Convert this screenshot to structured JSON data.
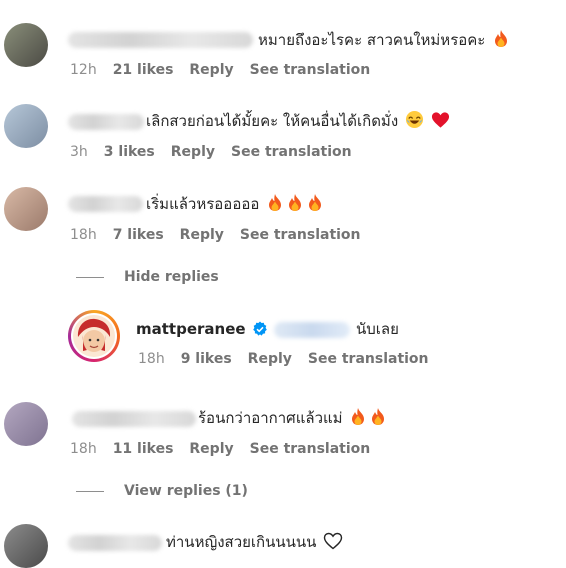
{
  "labels": {
    "reply": "Reply",
    "see_translation": "See translation"
  },
  "comments": [
    {
      "text": "หมายถึงอะไรคะ สาวคนใหม่หรอคะ",
      "age": "12h",
      "likes": "21 likes"
    },
    {
      "text": "เลิกสวยก่อนได้มั้ยคะ ให้คนอื่นได้เกิดมั่ง",
      "age": "3h",
      "likes": "3 likes"
    },
    {
      "text": "เริ่มแล้วหรอออออ",
      "age": "18h",
      "likes": "7 likes"
    },
    {
      "text": "ร้อนกว่าอากาศแล้วแม่",
      "age": "18h",
      "likes": "11 likes"
    },
    {
      "text": "ท่านหญิงสวยเกินนนนน"
    }
  ],
  "reply": {
    "username": "mattperanee",
    "text": "นับเลย",
    "age": "18h",
    "likes": "9 likes"
  },
  "toggles": {
    "hide": "Hide replies",
    "view": "View replies (1)"
  },
  "icons": [
    "fire-emoji",
    "laughing-emoji",
    "red-heart-emoji",
    "verified-badge-icon",
    "outline-heart-icon"
  ]
}
